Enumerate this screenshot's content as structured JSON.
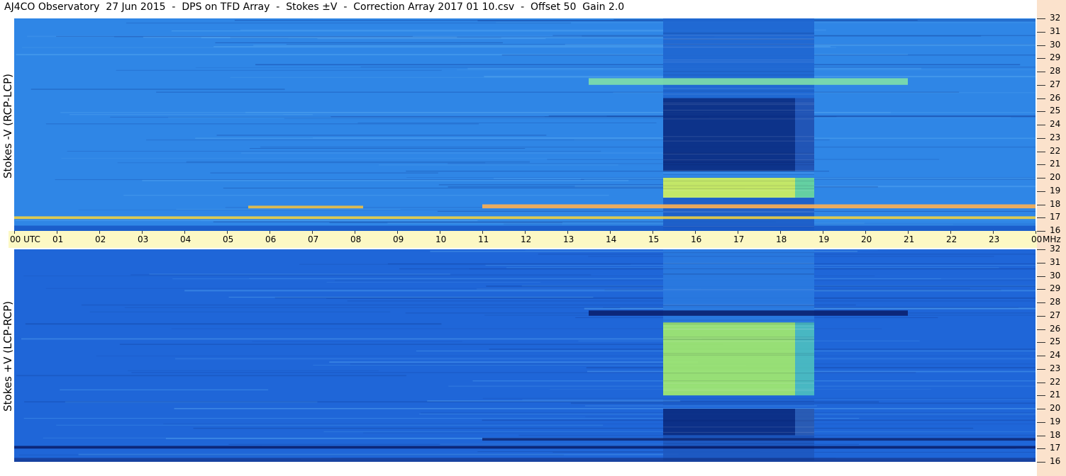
{
  "title": "AJ4CO Observatory  27 Jun 2015  -  DPS on TFD Array  -  Stokes ±V  -  Correction Array 2017 01 10.csv  -  Offset 50  Gain 2.0",
  "colors": {
    "right_strip": "#fbe2cc",
    "time_bar": "#fcf8c4"
  },
  "chart_data": [
    {
      "type": "heatmap",
      "panel": "top",
      "ylabel": "Stokes -V (RCP-LCP)",
      "y_units": "MHz",
      "ylim": [
        16,
        32
      ],
      "y_ticks": [
        "32",
        "31",
        "30",
        "29",
        "28",
        "27",
        "26",
        "25",
        "24",
        "23",
        "22",
        "21",
        "20",
        "19",
        "18",
        "17",
        "16"
      ],
      "x_units": "UTC",
      "xlim": [
        0,
        24
      ],
      "background_color": "#2f86e6",
      "features": [
        {
          "t0": 15.25,
          "t1": 18.35,
          "f0": 20.5,
          "f1": 26.0,
          "color": "#0a2a80"
        },
        {
          "t0": 18.35,
          "t1": 18.8,
          "f0": 20.5,
          "f1": 26.0,
          "color": "#2050b0"
        },
        {
          "t0": 15.25,
          "t1": 18.35,
          "f0": 18.5,
          "f1": 20.0,
          "color": "#d4f25a"
        },
        {
          "t0": 18.35,
          "t1": 18.8,
          "f0": 18.5,
          "f1": 20.0,
          "color": "#6ad89a"
        },
        {
          "t0": 15.25,
          "t1": 18.8,
          "f0": 26.0,
          "f1": 32.0,
          "color": "#1f66d0"
        },
        {
          "t0": 15.25,
          "t1": 18.8,
          "f0": 16.0,
          "f1": 18.5,
          "color": "#1c5cc6"
        },
        {
          "t0": 13.5,
          "t1": 21.0,
          "f0": 27.0,
          "f1": 27.5,
          "color": "#7fe0a8"
        },
        {
          "t0": 5.5,
          "t1": 8.2,
          "f0": 17.7,
          "f1": 17.9,
          "color": "#f0c040"
        },
        {
          "t0": 11.0,
          "t1": 24.0,
          "f0": 17.7,
          "f1": 18.0,
          "color": "#ffb050"
        },
        {
          "t0": 0.0,
          "t1": 24.0,
          "f0": 16.9,
          "f1": 17.1,
          "color": "#f0d040"
        },
        {
          "t0": 0.0,
          "t1": 24.0,
          "f0": 16.0,
          "f1": 16.4,
          "color": "#1a5ac8"
        }
      ]
    },
    {
      "type": "heatmap",
      "panel": "bottom",
      "ylabel": "Stokes +V (LCP-RCP)",
      "y_units": "MHz",
      "ylim": [
        16,
        32
      ],
      "y_ticks": [
        "32",
        "31",
        "30",
        "29",
        "28",
        "27",
        "26",
        "25",
        "24",
        "23",
        "22",
        "21",
        "20",
        "19",
        "18",
        "17",
        "16"
      ],
      "x_units": "UTC",
      "xlim": [
        0,
        24
      ],
      "background_color": "#1f66d8",
      "features": [
        {
          "t0": 15.25,
          "t1": 18.35,
          "f0": 21.0,
          "f1": 26.5,
          "color": "#a4ec6c"
        },
        {
          "t0": 18.35,
          "t1": 18.8,
          "f0": 21.0,
          "f1": 26.5,
          "color": "#4cc0c0"
        },
        {
          "t0": 15.25,
          "t1": 18.35,
          "f0": 18.0,
          "f1": 20.0,
          "color": "#0a2a80"
        },
        {
          "t0": 18.35,
          "t1": 18.8,
          "f0": 18.0,
          "f1": 20.0,
          "color": "#2a5ab0"
        },
        {
          "t0": 15.25,
          "t1": 18.8,
          "f0": 26.5,
          "f1": 32.0,
          "color": "#2a7ae0"
        },
        {
          "t0": 15.25,
          "t1": 18.8,
          "f0": 16.0,
          "f1": 18.0,
          "color": "#1d58c0"
        },
        {
          "t0": 13.5,
          "t1": 21.0,
          "f0": 27.0,
          "f1": 27.4,
          "color": "#0a2070"
        },
        {
          "t0": 0.0,
          "t1": 24.0,
          "f0": 17.0,
          "f1": 17.2,
          "color": "#0a2070"
        },
        {
          "t0": 11.0,
          "t1": 24.0,
          "f0": 17.6,
          "f1": 17.8,
          "color": "#0e2a7a"
        },
        {
          "t0": 0.0,
          "t1": 24.0,
          "f0": 16.0,
          "f1": 16.3,
          "color": "#163e9a"
        }
      ]
    }
  ],
  "time_axis": {
    "labels": [
      "00 UTC",
      "01",
      "02",
      "03",
      "04",
      "05",
      "06",
      "07",
      "08",
      "09",
      "10",
      "11",
      "12",
      "13",
      "14",
      "15",
      "16",
      "17",
      "18",
      "19",
      "20",
      "21",
      "22",
      "23",
      "00"
    ],
    "end_unit": "MHz"
  }
}
